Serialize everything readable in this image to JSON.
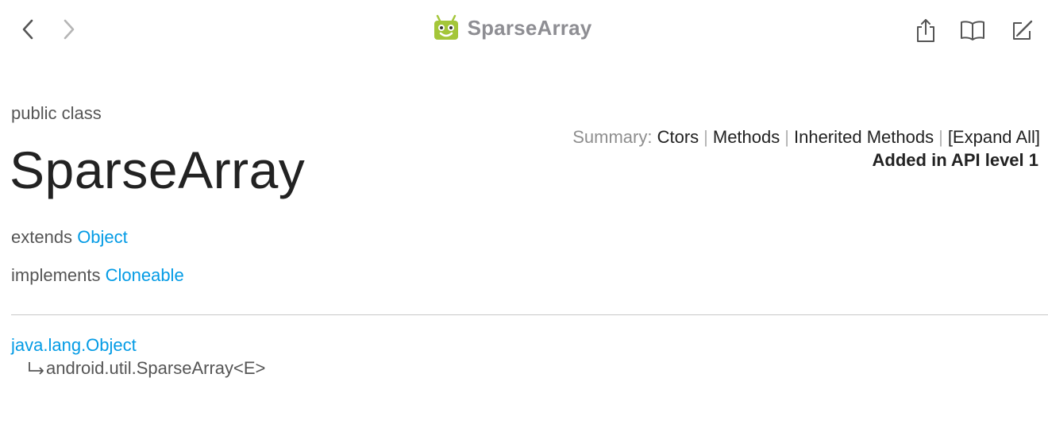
{
  "toolbar": {
    "title": "SparseArray",
    "back_icon": "chevron-left-icon",
    "forward_icon": "chevron-right-icon",
    "app_icon": "android-logo-icon",
    "share_icon": "share-icon",
    "bookmarks_icon": "book-icon",
    "edit_icon": "markup-icon"
  },
  "doc": {
    "class_kind": "public class",
    "class_name": "SparseArray",
    "summary": {
      "label": "Summary:",
      "links": [
        "Ctors",
        "Methods",
        "Inherited Methods",
        "[Expand All]"
      ],
      "separator": "|"
    },
    "api_level": "Added in API level 1",
    "extends": {
      "label": "extends",
      "link": "Object"
    },
    "implements": {
      "label": "implements",
      "link": "Cloneable"
    },
    "hierarchy": {
      "root": "java.lang.Object",
      "child": "android.util.SparseArray<E>"
    }
  },
  "colors": {
    "link": "#039be5",
    "title_gray": "#8e8e93",
    "android_green": "#a4c639"
  }
}
